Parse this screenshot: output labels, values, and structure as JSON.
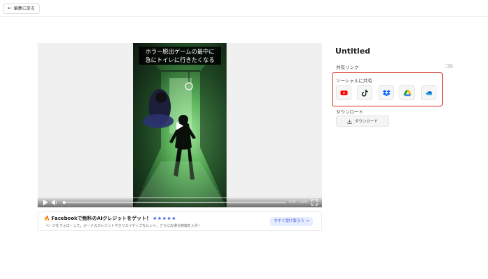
{
  "header": {
    "back_label": "編集に戻る"
  },
  "video": {
    "caption_line1": "ホラー脱出ゲームの最中に",
    "caption_line2": "急にトイレに行きたくなる",
    "time": "0:00 / 0:00",
    "progress": 0
  },
  "promo": {
    "title": "Facebookで無料のAIクレジットをゲット！",
    "stars": "★★★★★",
    "description": "ページをフォローして、ボーナスクレジットやクリエイティブなヒント、さらにお得な特典を入手！",
    "button_label": "今すぐ受け取ろう →"
  },
  "panel": {
    "title": "Untitled",
    "share_link_label": "共有リンク",
    "share_link_enabled": false,
    "social_share_label": "ソーシャルに共有",
    "download_section_label": "ダウンロード",
    "download_button_label": "ダウンロード"
  },
  "share_targets": [
    {
      "name": "youtube",
      "color": "#ff0000"
    },
    {
      "name": "tiktok",
      "color": "#000000"
    },
    {
      "name": "dropbox",
      "color": "#0061fe"
    },
    {
      "name": "google-drive",
      "color": "#34a853"
    },
    {
      "name": "onedrive",
      "color": "#0364b8"
    }
  ]
}
